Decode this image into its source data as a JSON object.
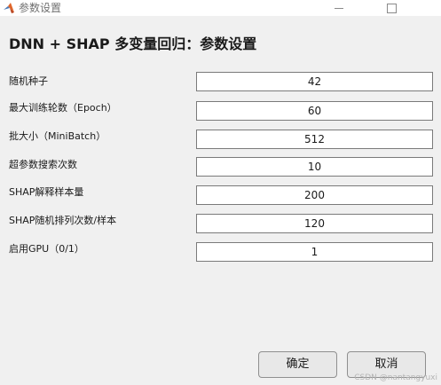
{
  "window": {
    "title": "参数设置",
    "app_icon": "matlab-logo-icon",
    "controls": [
      "minimize-icon",
      "maximize-icon"
    ]
  },
  "heading": "DNN + SHAP 多变量回归：参数设置",
  "fields": [
    {
      "label": "随机种子",
      "value": "42"
    },
    {
      "label": "最大训练轮数（Epoch）",
      "value": "60"
    },
    {
      "label": "批大小（MiniBatch）",
      "value": "512"
    },
    {
      "label": "超参数搜索次数",
      "value": "10"
    },
    {
      "label": "SHAP解释样本量",
      "value": "200"
    },
    {
      "label": "SHAP随机排列次数/样本",
      "value": "120"
    },
    {
      "label": "启用GPU（0/1）",
      "value": "1"
    }
  ],
  "buttons": {
    "ok": "确定",
    "cancel": "取消"
  },
  "watermark": "CSDN @nantangyuxi",
  "colors": {
    "dialog_bg": "#f0f0f0",
    "field_border": "#7a7a7a",
    "button_bg": "#e8e8e8"
  }
}
